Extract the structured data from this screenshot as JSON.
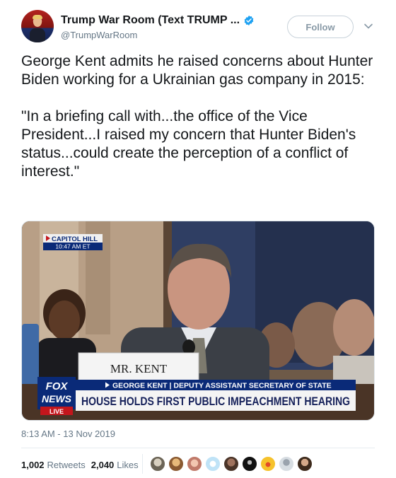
{
  "tweet": {
    "display_name": "Trump War Room (Text TRUMP ...",
    "handle": "@TrumpWarRoom",
    "follow_label": "Follow",
    "text": "George Kent admits he raised concerns about Hunter Biden working for a Ukrainian gas company in 2015:\n\n\"In a briefing call with...the office of the Vice President...I raised my concern that Hunter Biden's status...could create the perception of a conflict of interest.\"",
    "timestamp": "8:13 AM - 13 Nov 2019",
    "retweets_count": "1,002",
    "retweets_label": "Retweets",
    "likes_count": "2,040",
    "likes_label": "Likes"
  },
  "media": {
    "location_label": "CAPITOL HILL",
    "time_label": "10:47 AM ET",
    "nameplate": "MR. KENT",
    "lower_third_name": "GEORGE KENT | DEPUTY ASSISTANT SECRETARY OF STATE",
    "headline": "HOUSE HOLDS FIRST PUBLIC IMPEACHMENT HEARING",
    "network_top": "FOX",
    "network_bottom": "NEWS",
    "live_label": "LIVE"
  },
  "icons": {
    "verified": "verified-badge-icon",
    "caret": "chevron-down-icon"
  },
  "colors": {
    "verified_blue": "#1da1f2",
    "text": "#14171a",
    "secondary": "#657786",
    "fox_blue": "#0a2a78",
    "headline_blue": "#16215a"
  }
}
